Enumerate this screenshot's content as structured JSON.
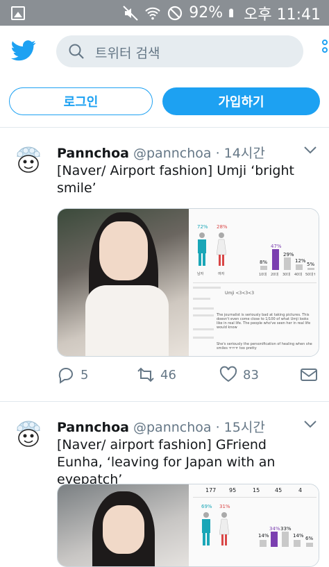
{
  "status_bar": {
    "battery": "92%",
    "time": "오후 11:41",
    "icons": [
      "gallery-icon",
      "mute-icon",
      "wifi-icon",
      "block-icon",
      "battery-icon"
    ]
  },
  "header": {
    "logo": "twitter-bird-icon",
    "search_placeholder": "트위터 검색",
    "more_icon": "more-dots-icon",
    "accent": "#1da1f2"
  },
  "auth": {
    "login_label": "로그인",
    "signup_label": "가입하기"
  },
  "tweets": [
    {
      "name": "Pannchoa",
      "handle": "@pannchoa",
      "time": "· 14시간",
      "text": "[Naver/ Airport fashion] Umji ‘bright smile’",
      "media": {
        "male_pct": "72%",
        "female_pct": "28%",
        "male_label": "남자",
        "female_label": "여자",
        "age_pcts": [
          "8%",
          "47%",
          "29%",
          "12%",
          "5%"
        ],
        "age_labels": [
          "10대",
          "20대",
          "30대",
          "40대",
          "50대↑"
        ],
        "comment_1": "Umji <3<3<3",
        "comment_2": "The journalist is seriously bad at taking pictures. This doesn't even come close to 1/100 of what Umji looks like in real life. The people who've seen her in real life would know",
        "comment_3": "She's seriously the personification of healing when she smiles ㅠㅠㅠ too pretty"
      },
      "replies": "5",
      "retweets": "46",
      "likes": "83"
    },
    {
      "name": "Pannchoa",
      "handle": "@pannchoa",
      "time": "· 15시간",
      "text": "[Naver/ airport fashion] GFriend Eunha, ‘leaving for Japan with an eyepatch’",
      "media": {
        "counts": [
          "177",
          "95",
          "15",
          "45",
          "4"
        ],
        "male_pct": "69%",
        "female_pct": "31%",
        "age_pcts": [
          "14%",
          "34%",
          "33%",
          "14%",
          "6%"
        ]
      }
    }
  ]
}
